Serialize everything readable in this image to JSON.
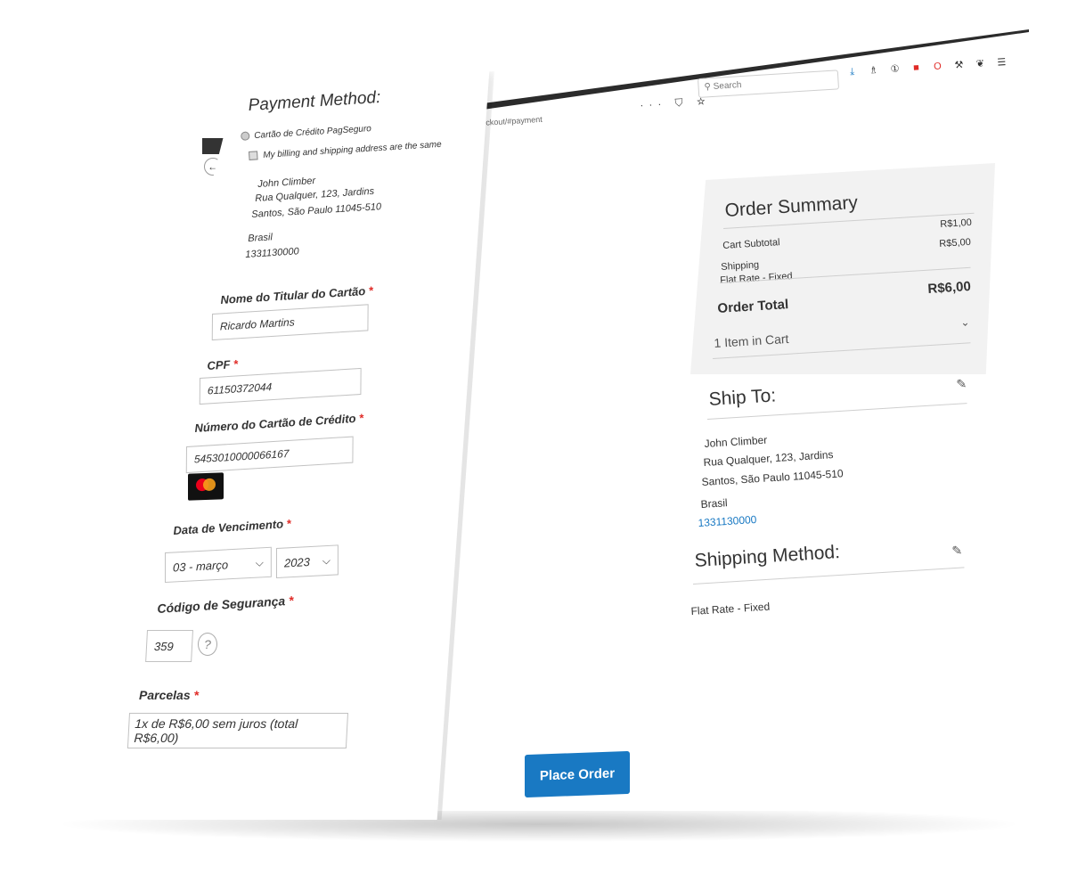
{
  "browser": {
    "url_fragment": "eckout/#payment",
    "search_placeholder": "Search",
    "toolbar_icons": "··· ⛉ ☆",
    "menu_icon": "☰"
  },
  "order_summary": {
    "title": "Order Summary",
    "cart_subtotal_label": "Cart Subtotal",
    "cart_subtotal_value": "R$1,00",
    "shipping_label": "Shipping",
    "shipping_sub": "Flat Rate - Fixed",
    "shipping_value": "R$5,00",
    "order_total_label": "Order Total",
    "order_total_value": "R$6,00",
    "items_in_cart": "1 Item in Cart"
  },
  "ship_to": {
    "title": "Ship To:",
    "name": "John Climber",
    "street": "Rua Qualquer, 123, Jardins",
    "city": "Santos, São Paulo 11045-510",
    "country": "Brasil",
    "phone": "1331130000"
  },
  "shipping_method": {
    "title": "Shipping Method:",
    "value": "Flat Rate - Fixed"
  },
  "place_order": {
    "label": "Place Order"
  },
  "payment": {
    "title": "Payment Method:",
    "method_label": "Cartão de Crédito PagSeguro",
    "same_address_label": "My billing and shipping address are the same",
    "name": "John Climber",
    "street": "Rua Qualquer, 123, Jardins",
    "city": "Santos, São Paulo 11045-510",
    "country": "Brasil",
    "phone": "1331130000",
    "holder_label": "Nome do Titular do Cartão",
    "holder_value": "Ricardo Martins",
    "cpf_label": "CPF",
    "cpf_value": "61150372044",
    "card_number_label": "Número do Cartão de Crédito",
    "card_number_value": "5453010000066167",
    "expiry_label": "Data de Vencimento",
    "expiry_month": "03 - março",
    "expiry_year": "2023",
    "cvv_label": "Código de Segurança",
    "cvv_value": "359",
    "installments_label": "Parcelas",
    "installments_value": "1x de R$6,00 sem juros (total R$6,00)",
    "required_mark": "*"
  },
  "colors": {
    "accent": "#1979c3",
    "required": "#e02b27",
    "summary_bg": "#f2f2f2"
  }
}
